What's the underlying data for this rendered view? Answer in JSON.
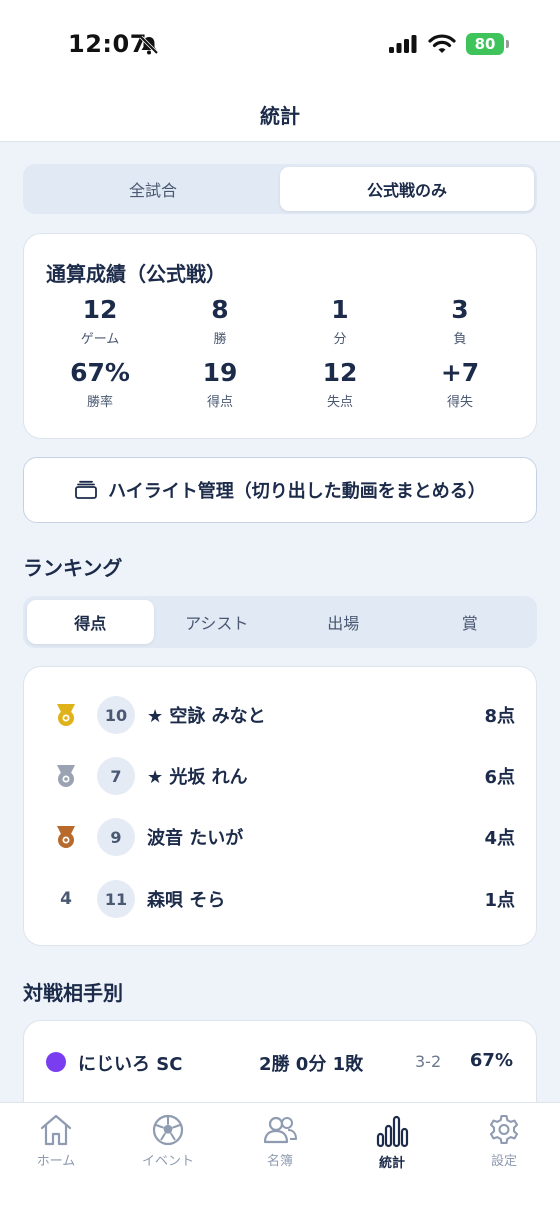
{
  "status": {
    "time": "12:07",
    "battery": "80"
  },
  "nav": {
    "title": "統計"
  },
  "filter": {
    "options": [
      "全試合",
      "公式戦のみ"
    ],
    "selected": "公式戦のみ"
  },
  "summary": {
    "title": "通算成績（公式戦）",
    "stats": [
      {
        "value": "12",
        "label": "ゲーム"
      },
      {
        "value": "8",
        "label": "勝"
      },
      {
        "value": "1",
        "label": "分"
      },
      {
        "value": "3",
        "label": "負"
      },
      {
        "value": "67%",
        "label": "勝率"
      },
      {
        "value": "19",
        "label": "得点"
      },
      {
        "value": "12",
        "label": "失点"
      },
      {
        "value": "+7",
        "label": "得失"
      }
    ]
  },
  "highlight": {
    "label": "ハイライト管理（切り出した動画をまとめる）"
  },
  "ranking": {
    "title": "ランキング",
    "tabs": [
      "得点",
      "アシスト",
      "出場",
      "賞"
    ],
    "selected_tab": "得点",
    "rows": [
      {
        "rank": "1",
        "medal": "gold",
        "number": "10",
        "name": "★ 空詠 みなと",
        "score": "8点"
      },
      {
        "rank": "2",
        "medal": "silver",
        "number": "7",
        "name": "★ 光坂 れん",
        "score": "6点"
      },
      {
        "rank": "3",
        "medal": "bronze",
        "number": "9",
        "name": "波音 たいが",
        "score": "4点"
      },
      {
        "rank": "4",
        "medal": "",
        "number": "11",
        "name": "森唄 そら",
        "score": "1点"
      }
    ]
  },
  "opponents": {
    "title": "対戦相手別",
    "rows": [
      {
        "name": "にじいろ SC",
        "record": "2勝 0分 1敗",
        "score": "3-2",
        "rate": "67%",
        "color": "#7a3ef0"
      }
    ]
  },
  "tabbar": {
    "items": [
      {
        "label": "ホーム",
        "icon": "home-icon"
      },
      {
        "label": "イベント",
        "icon": "soccer-ball-icon"
      },
      {
        "label": "名簿",
        "icon": "people-icon"
      },
      {
        "label": "統計",
        "icon": "bar-chart-icon"
      },
      {
        "label": "設定",
        "icon": "gear-icon"
      }
    ],
    "active": "統計"
  },
  "colors": {
    "gold": "#e0b21a",
    "silver": "#9aa3b1",
    "bronze": "#b86a2c",
    "navy": "#1c2b4a",
    "background": "#eef3fa"
  }
}
